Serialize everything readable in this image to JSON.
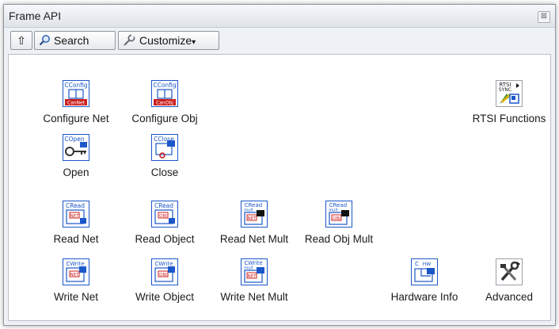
{
  "window": {
    "title": "Frame API",
    "close_glyph": "⊠"
  },
  "toolbar": {
    "up_glyph": "⇧",
    "search_label": "Search",
    "customize_label": "Customize",
    "customize_arrow": "▾"
  },
  "icons": {
    "configure_net": {
      "label": "Configure Net",
      "tag": "CConfig",
      "sub": "CanNet"
    },
    "configure_obj": {
      "label": "Configure Obj",
      "tag": "CConfig",
      "sub": "CanObj"
    },
    "open": {
      "label": "Open",
      "tag": "COpen"
    },
    "close": {
      "label": "Close",
      "tag": "CClose"
    },
    "read_net": {
      "label": "Read Net",
      "tag": "CRead",
      "sub": "NET"
    },
    "read_object": {
      "label": "Read Object",
      "tag": "CRead",
      "sub": "OBJ"
    },
    "read_net_mult": {
      "label": "Read Net Mult",
      "tag": "CRead",
      "tag2": "mult",
      "sub": "NET"
    },
    "read_obj_mult": {
      "label": "Read Obj Mult",
      "tag": "CRead",
      "tag2": "mult",
      "sub": "OBJ"
    },
    "write_net": {
      "label": "Write Net",
      "tag": "CWrite",
      "sub": "NET"
    },
    "write_object": {
      "label": "Write Object",
      "tag": "CWrite",
      "sub": "OBJ"
    },
    "write_net_mult": {
      "label": "Write Net Mult",
      "tag": "CWrite",
      "tag2": "mult",
      "sub": "NET"
    },
    "hardware_info": {
      "label": "Hardware Info",
      "tag": "C",
      "tag2": "HW"
    },
    "rtsi_functions": {
      "label": "RTSI Functions",
      "tag": "RTSI",
      "tag2": "SYNC"
    },
    "advanced": {
      "label": "Advanced"
    }
  },
  "colors": {
    "icon_blue": "#1b57c9",
    "icon_red": "#cc1f1f",
    "palette_bg": "#eef1f5"
  }
}
